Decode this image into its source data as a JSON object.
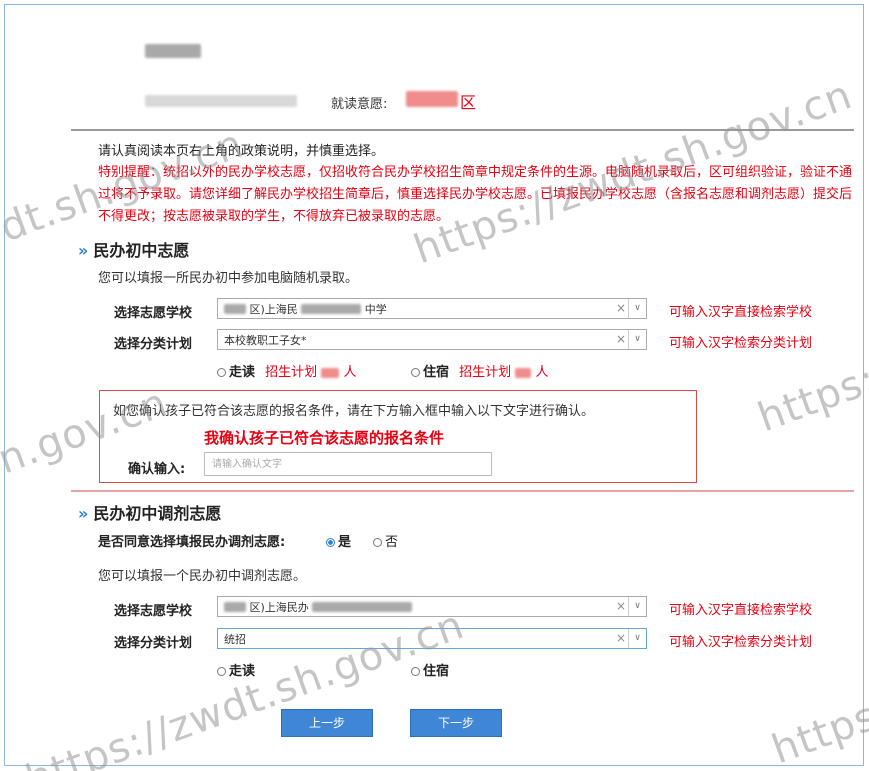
{
  "header": {
    "intent_label": "就读意愿:",
    "intent_value": "区"
  },
  "notice": {
    "read_tip": "请认真阅读本页右上角的政策说明，并慎重选择。",
    "warning": "特别提醒：统招以外的民办学校志愿，仅招收符合民办学校招生简章中规定条件的生源。电脑随机录取后，区可组织验证，验证不通过将不予录取。请您详细了解民办学校招生简章后，慎重选择民办学校志愿。已填报民办学校志愿（含报名志愿和调剂志愿）提交后不得更改；按志愿被录取的学生，不得放弃已被录取的志愿。"
  },
  "section1": {
    "arrow": "»",
    "title": "民办初中志愿",
    "desc": "您可以填报一所民办初中参加电脑随机录取。",
    "school": {
      "label": "选择志愿学校",
      "value_prefix": "区)上海民",
      "value_suffix": "中学",
      "hint": "可输入汉字直接检索学校"
    },
    "plan": {
      "label": "选择分类计划",
      "value": "本校教职工子女*",
      "hint": "可输入汉字检索分类计划"
    },
    "day": {
      "label": "走读",
      "plan_text": "招生计划",
      "unit": "人"
    },
    "boarding": {
      "label": "住宿",
      "plan_text": "招生计划",
      "unit": "人"
    },
    "confirm": {
      "tip": "如您确认孩子已符合该志愿的报名条件，请在下方输入框中输入以下文字进行确认。",
      "phrase": "我确认孩子已符合该志愿的报名条件",
      "label": "确认输入:",
      "placeholder": "请输入确认文字"
    }
  },
  "section2": {
    "arrow": "»",
    "title": "民办初中调剂志愿",
    "agree_label": "是否同意选择填报民办调剂志愿:",
    "yes": "是",
    "no": "否",
    "selected": "是",
    "desc": "您可以填报一个民办初中调剂志愿。",
    "school": {
      "label": "选择志愿学校",
      "value_prefix": "区)上海民办",
      "hint": "可输入汉字直接检索学校"
    },
    "plan": {
      "label": "选择分类计划",
      "value": "统招",
      "hint": "可输入汉字检索分类计划"
    },
    "day": {
      "label": "走读"
    },
    "boarding": {
      "label": "住宿"
    }
  },
  "select_controls": {
    "clear": "×",
    "caret": "∨"
  },
  "buttons": {
    "prev": "上一步",
    "next": "下一步"
  },
  "watermarks": {
    "a": "dt.sh.gov.cn",
    "b": "https://zwdt.sh.gov.cn",
    "c": "https:/",
    "d": "n.gov.cn",
    "e": "https://zwdt.sh.gov.cn",
    "f": "https:"
  },
  "colors": {
    "accent_blue": "#2f7fd1",
    "button_blue": "#3f87d6",
    "warning_red": "#e60012"
  }
}
